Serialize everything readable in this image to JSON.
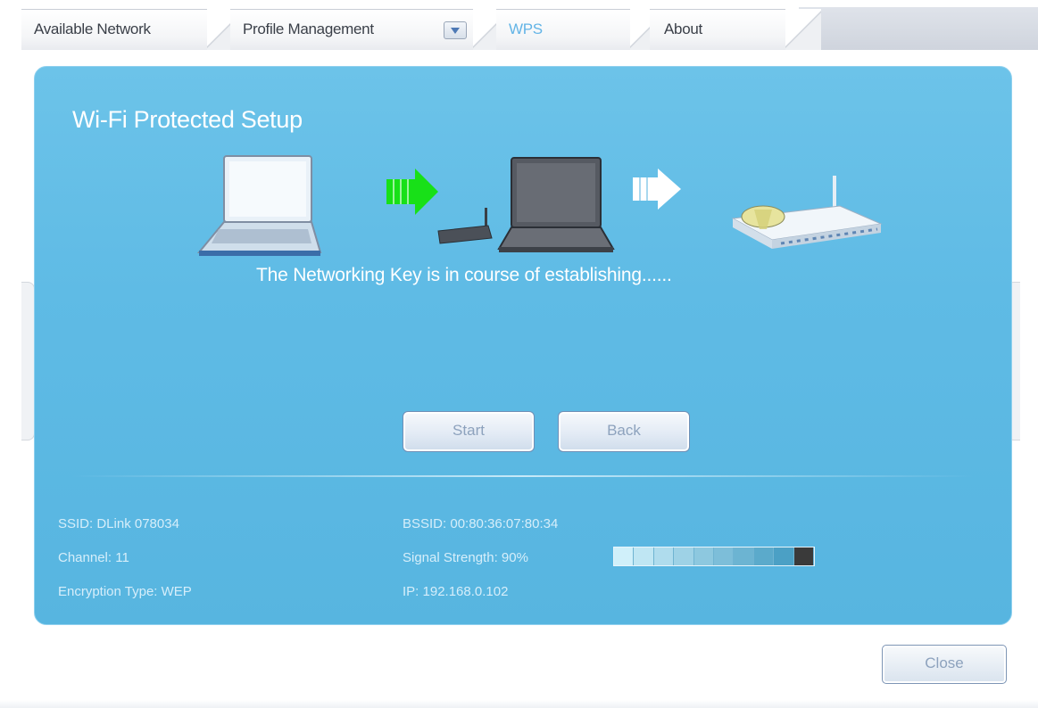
{
  "tabs": [
    {
      "label": "Available Network"
    },
    {
      "label": "Profile Management"
    },
    {
      "label": "WPS"
    },
    {
      "label": "About"
    }
  ],
  "active_tab": "WPS",
  "wps": {
    "title": "Wi-Fi Protected Setup",
    "status": "The Networking Key is  in course of establishing......",
    "start_label": "Start",
    "back_label": "Back"
  },
  "connection": {
    "ssid": "SSID: DLink 078034",
    "channel": "Channel: 11",
    "encryption": "Encryption Type: WEP",
    "bssid": "BSSID: 00:80:36:07:80:34",
    "signal": "Signal Strength: 90%",
    "ip": "IP: 192.168.0.102",
    "signal_fraction": 0.9
  },
  "footer": {
    "close_label": "Close"
  },
  "colors": {
    "panel": "#5fbbe5",
    "active_tab_text": "#63b4e6",
    "arrow_green": "#18e018"
  },
  "icons": [
    "laptop-icon",
    "green-arrow-icon",
    "router-icon",
    "white-arrow-icon",
    "access-point-icon",
    "dropdown-arrow-icon"
  ]
}
